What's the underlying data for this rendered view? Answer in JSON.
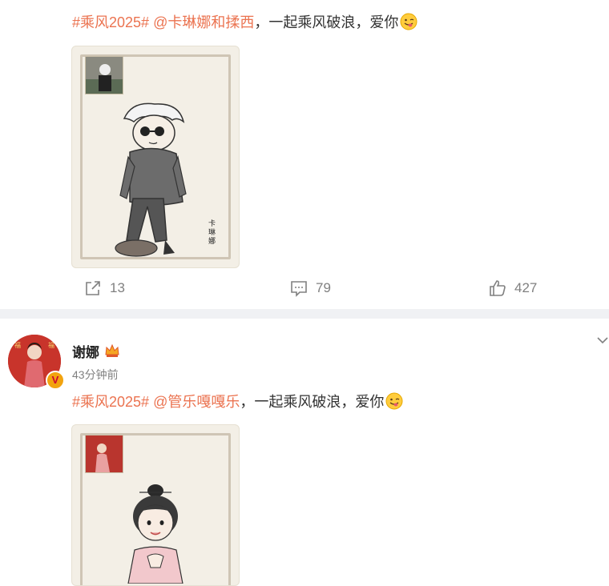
{
  "post1": {
    "hashtag": "#乘风2025#",
    "mention": "@卡琳娜和揉西",
    "text": "，一起乘风破浪，爱你",
    "emoji": "winking-tongue-emoji",
    "image_signature": "卡琳娜",
    "actions": {
      "repost": "13",
      "comment": "79",
      "like": "427"
    }
  },
  "post2": {
    "author": "谢娜",
    "time": "43分钟前",
    "hashtag": "#乘风2025#",
    "mention": "@管乐嘎嘎乐",
    "text": "，一起乘风破浪，爱你",
    "emoji": "winking-tongue-emoji"
  },
  "colors": {
    "accent": "#eb7350",
    "divider": "#f0f1f4",
    "muted": "#808080"
  }
}
